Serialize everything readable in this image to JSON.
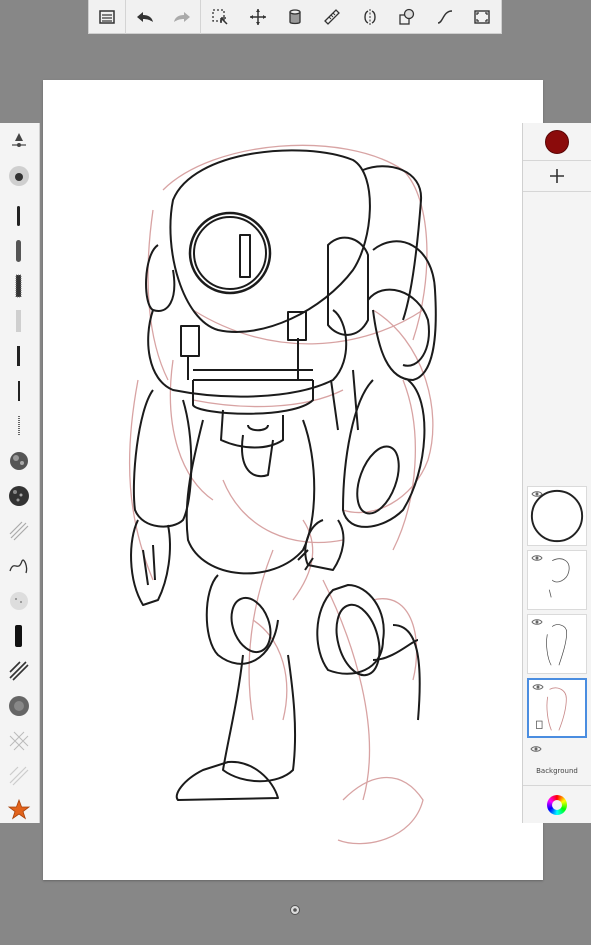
{
  "toolbar": {
    "tools": [
      {
        "name": "layers-list-icon"
      },
      {
        "name": "undo-icon"
      },
      {
        "name": "redo-icon"
      },
      {
        "name": "selection-icon"
      },
      {
        "name": "transform-move-icon"
      },
      {
        "name": "fill-bucket-icon"
      },
      {
        "name": "ruler-icon"
      },
      {
        "name": "symmetry-icon"
      },
      {
        "name": "shapes-icon"
      },
      {
        "name": "curve-icon"
      },
      {
        "name": "fullscreen-icon"
      }
    ]
  },
  "brushes": [
    "brush-slider-icon",
    "airbrush",
    "pencil-brush",
    "soft-marker-brush",
    "chalk-brush",
    "light-pencil-brush",
    "ink-brush",
    "fine-ink-brush",
    "dotted-brush",
    "splatter-brush",
    "noise-brush",
    "hatch-brush",
    "scribble-brush",
    "speckle-brush",
    "bold-marker-brush",
    "diagonal-hatch-brush",
    "stipple-brush",
    "crosshatch-brush",
    "texture-brush",
    "favorite-star-icon"
  ],
  "layers": {
    "items": [
      {
        "name": "layer-1",
        "selected": false
      },
      {
        "name": "layer-2",
        "selected": false
      },
      {
        "name": "layer-3",
        "selected": false
      },
      {
        "name": "layer-4",
        "selected": true
      },
      {
        "name": "background-layer",
        "label": "Background",
        "selected": false
      }
    ]
  },
  "colors": {
    "current": "#8b0b0b",
    "selection": "#4a8de0",
    "toolbar_bg": "#f1f1f1",
    "workspace_bg": "#878787"
  }
}
